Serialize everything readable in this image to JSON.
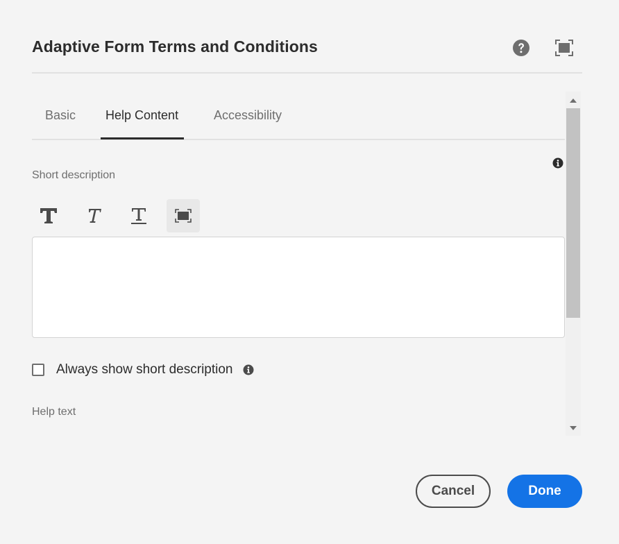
{
  "dialog": {
    "title": "Adaptive Form Terms and Conditions",
    "help_icon": "help-circle-icon",
    "fullscreen_icon": "fullscreen-icon"
  },
  "tabs": [
    {
      "label": "Basic",
      "active": false
    },
    {
      "label": "Help Content",
      "active": true
    },
    {
      "label": "Accessibility",
      "active": false
    }
  ],
  "short_description": {
    "label": "Short description",
    "toolbar": [
      "bold-icon",
      "italic-icon",
      "underline-icon",
      "expand-icon"
    ],
    "value": ""
  },
  "always_show": {
    "label": "Always show short description",
    "checked": false
  },
  "help_text": {
    "label": "Help text"
  },
  "footer": {
    "cancel_label": "Cancel",
    "done_label": "Done"
  },
  "colors": {
    "accent": "#1473e6",
    "background": "#f4f4f4",
    "text": "#2c2c2c"
  }
}
